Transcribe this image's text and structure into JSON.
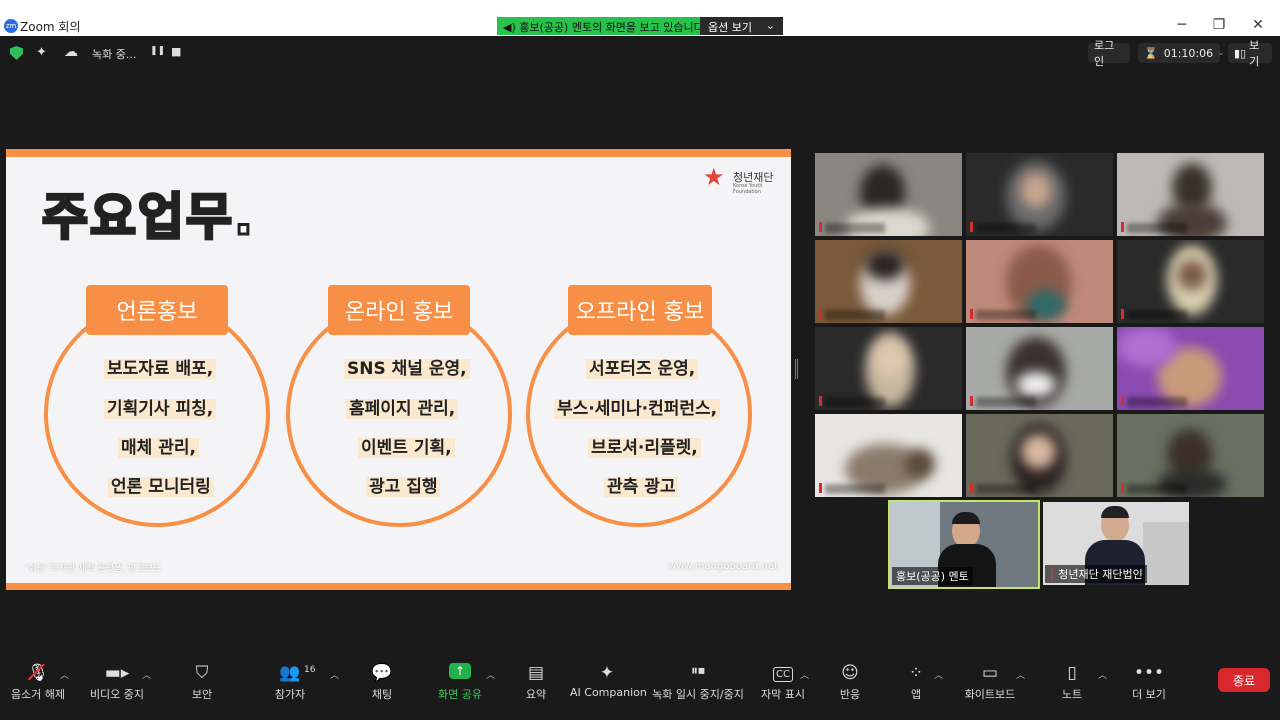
{
  "window": {
    "app_logo": "zm",
    "title": "Zoom 회의",
    "share_banner": "홍보(공공) 멘토의 화면을 보고 있습니다",
    "share_options": "옵션 보기",
    "minimize": "─",
    "maximize": "❐",
    "close": "✕"
  },
  "status": {
    "recording_label": "녹화 중...",
    "pause_icon": "❚❚",
    "stop_icon": "■",
    "login": "로그인",
    "timer": "01:10:06",
    "view": "보기"
  },
  "slide": {
    "title": "주요업무.",
    "logo_name": "청년재단",
    "logo_sub": "Korea Youth Foundation",
    "footer_left": "'쉬운' 디자인 제작 플랫폼, 망고보드",
    "footer_right": "www.mangoboard.net",
    "sections": [
      {
        "label": "언론홍보",
        "items": [
          "보도자료 배포,",
          "기획기사 피칭,",
          "매체 관리,",
          "언론 모니터링"
        ]
      },
      {
        "label": "온라인 홍보",
        "items": [
          "SNS 채널 운영,",
          "홈페이지 관리,",
          "이벤트 기획,",
          "광고 집행"
        ]
      },
      {
        "label": "오프라인 홍보",
        "items": [
          "서포터즈 운영,",
          "부스·세미나·컨퍼런스,",
          "브로셔·리플렛,",
          "관측 광고"
        ]
      }
    ]
  },
  "speakers": [
    {
      "name": "홍보(공공) 멘토"
    },
    {
      "name": "청년재단 재단법인"
    }
  ],
  "toolbar": {
    "mute": "음소거 해제",
    "video": "비디오 중지",
    "security": "보안",
    "participants": "참가자",
    "participants_count": "16",
    "chat": "채팅",
    "share": "화면 공유",
    "summary": "요약",
    "ai": "AI Companion",
    "record": "녹화 일시 중지/중지",
    "captions": "자막 표시",
    "reactions": "반응",
    "apps": "앱",
    "whiteboard": "화이트보드",
    "notes": "노트",
    "more": "더 보기",
    "end": "종료"
  },
  "colors": {
    "accent_orange": "#f79046",
    "share_green": "#27c24c",
    "end_red": "#d9272e",
    "active_speaker": "#c9e36a"
  }
}
